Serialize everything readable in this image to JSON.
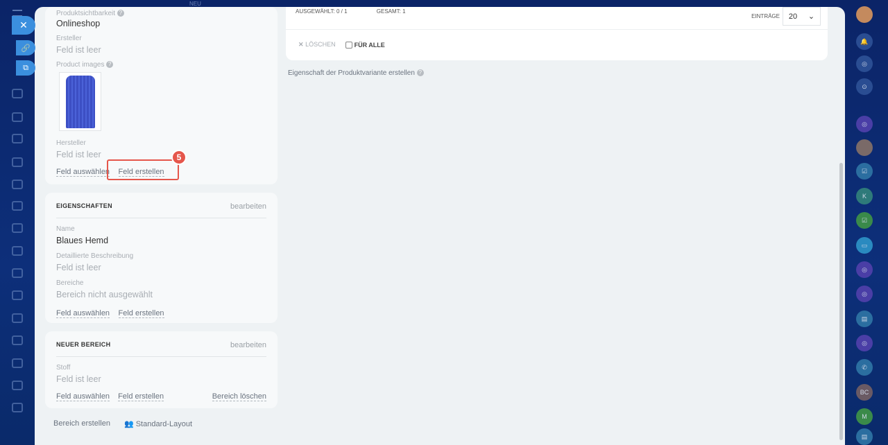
{
  "product": {
    "visibility_label": "Produktsichtbarkeit",
    "visibility_value": "Onlineshop",
    "creator_label": "Ersteller",
    "creator_value": "Feld ist leer",
    "images_label": "Product images",
    "manufacturer_label": "Hersteller",
    "manufacturer_value": "Feld ist leer",
    "select_field": "Feld auswählen",
    "create_field": "Feld erstellen",
    "step_badge": "5"
  },
  "properties": {
    "title": "EIGENSCHAFTEN",
    "edit": "bearbeiten",
    "name_label": "Name",
    "name_value": "Blaues Hemd",
    "desc_label": "Detaillierte Beschreibung",
    "desc_value": "Feld ist leer",
    "sections_label": "Bereiche",
    "sections_value": "Bereich nicht ausgewählt",
    "select_field": "Feld auswählen",
    "create_field": "Feld erstellen"
  },
  "new_section": {
    "title": "NEUER BEREICH",
    "edit": "bearbeiten",
    "fabric_label": "Stoff",
    "fabric_value": "Feld ist leer",
    "select_field": "Feld auswählen",
    "create_field": "Feld erstellen",
    "delete_section": "Bereich löschen"
  },
  "footer": {
    "create_section": "Bereich erstellen",
    "standard_layout": "Standard-Layout"
  },
  "grid": {
    "selected": "AUSGEWÄHLT: 0 / 1",
    "total": "GESAMT: 1",
    "entries_label": "EINTRÄGE",
    "entries_value": "20",
    "delete": "LÖSCHEN",
    "for_all": "FÜR ALLE",
    "create_variant_property": "Eigenschaft der Produktvariante erstellen"
  },
  "top": {
    "new_label": "NEU"
  },
  "right_bar": [
    "K",
    "BC",
    "M"
  ],
  "colors": {
    "accent": "#3b8fde",
    "highlight": "#e5564b"
  }
}
